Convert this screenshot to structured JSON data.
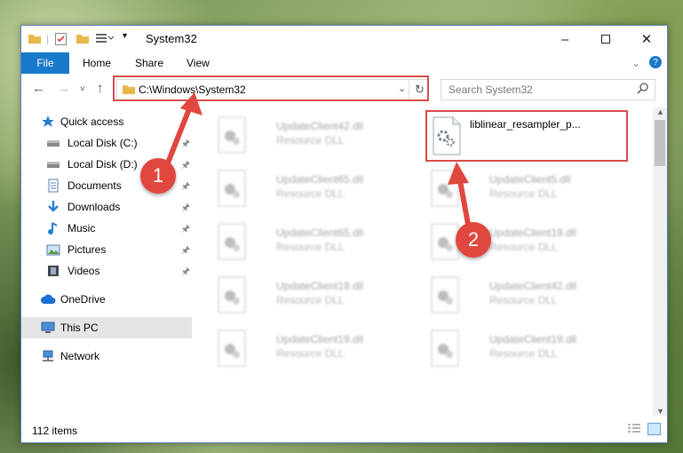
{
  "window": {
    "title": "System32"
  },
  "ribbon": {
    "tabs": [
      "File",
      "Home",
      "Share",
      "View"
    ]
  },
  "address": {
    "path": "C:\\Windows\\System32"
  },
  "search": {
    "placeholder": "Search System32"
  },
  "sidebar": {
    "items": [
      {
        "label": "Quick access",
        "icon": "star-icon",
        "pinned": false
      },
      {
        "label": "Local Disk (C:)",
        "icon": "drive-icon",
        "pinned": true
      },
      {
        "label": "Local Disk (D:)",
        "icon": "drive-icon",
        "pinned": true
      },
      {
        "label": "Documents",
        "icon": "documents-icon",
        "pinned": true
      },
      {
        "label": "Downloads",
        "icon": "download-icon",
        "pinned": true
      },
      {
        "label": "Music",
        "icon": "music-icon",
        "pinned": true
      },
      {
        "label": "Pictures",
        "icon": "pictures-icon",
        "pinned": true
      },
      {
        "label": "Videos",
        "icon": "videos-icon",
        "pinned": true
      },
      {
        "label": "OneDrive",
        "icon": "cloud-icon",
        "pinned": false
      },
      {
        "label": "This PC",
        "icon": "computer-icon",
        "pinned": false,
        "selected": true
      },
      {
        "label": "Network",
        "icon": "network-icon",
        "pinned": false
      }
    ]
  },
  "files": [
    {
      "name": "UpdateClient42.dll",
      "type": "Resource DLL"
    },
    {
      "name": "liblinear_resampler_p...",
      "type": ""
    },
    {
      "name": "UpdateClient65.dll",
      "type": "Resource DLL"
    },
    {
      "name": "UpdateClient5.dll",
      "type": "Resource DLL"
    },
    {
      "name": "UpdateClient65.dll",
      "type": "Resource DLL"
    },
    {
      "name": "UpdateClient19.dll",
      "type": "Resource DLL"
    },
    {
      "name": "UpdateClient19.dll",
      "type": "Resource DLL"
    },
    {
      "name": "UpdateClient42.dll",
      "type": "Resource DLL"
    },
    {
      "name": "UpdateClient19.dll",
      "type": "Resource DLL"
    },
    {
      "name": "UpdateClient19.dll",
      "type": "Resource DLL"
    }
  ],
  "status": {
    "item_count": "112 items"
  },
  "annotations": {
    "marker1": "1",
    "marker2": "2",
    "color": "#e0473f"
  },
  "colors": {
    "accent": "#1979ca",
    "selection": "#cce8ff"
  }
}
